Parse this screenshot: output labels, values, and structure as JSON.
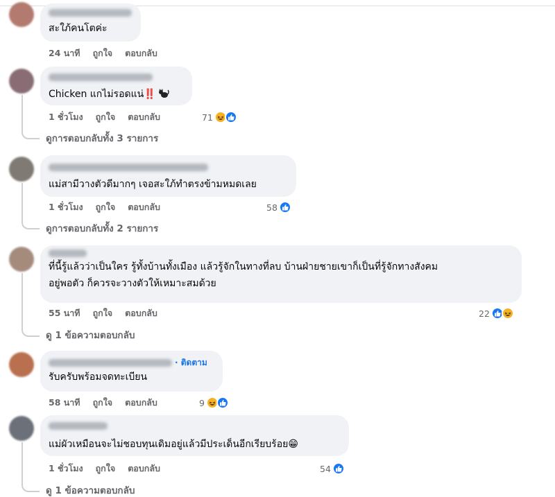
{
  "comments": [
    {
      "text": "สะใภ้คนโตค่ะ",
      "time": "24 นาที",
      "like_label": "ถูกใจ",
      "reply_label": "ตอบกลับ",
      "avatar_color": "#b37a6f"
    },
    {
      "text_main": "Chicken แกไม่รอดแน่",
      "text_emoji": "‼️",
      "time": "1 ชั่วโมง",
      "like_label": "ถูกใจ",
      "reply_label": "ตอบกลับ",
      "reaction_count": "71",
      "reactions": [
        "haha",
        "like"
      ],
      "view_replies": "ดูการตอบกลับทั้ง 3 รายการ",
      "avatar_color": "#8a6c74"
    },
    {
      "text": "แม่สามีวางตัวดีมากๆ เจอสะใภ้ทำตรงข้ามหมดเลย",
      "time": "1 ชั่วโมง",
      "like_label": "ถูกใจ",
      "reply_label": "ตอบกลับ",
      "reaction_count": "58",
      "reactions": [
        "like"
      ],
      "view_replies": "ดูการตอบกลับทั้ง 2 รายการ",
      "avatar_color": "#7f7a73"
    },
    {
      "text": "ที่นี้รู้แล้วว่าเป็นใคร รู้ทั้งบ้านทั้งเมือง แล้วรู้จักในทางที่ลบ บ้านฝ่ายชายเขาก็เป็นที่รู้จักทางสังคม\nอยู่พอตัว ก็ควรจะวางตัวให้เหมาะสมด้วย",
      "time": "55 นาที",
      "like_label": "ถูกใจ",
      "reply_label": "ตอบกลับ",
      "reaction_count": "22",
      "reactions": [
        "like",
        "haha"
      ],
      "view_replies": "ดู 1 ข้อความตอบกลับ",
      "avatar_color": "#a58b7c"
    },
    {
      "follow_label": "· ติดตาม",
      "text": "รับครับพร้อมจดทะเบียน",
      "time": "58 นาที",
      "like_label": "ถูกใจ",
      "reply_label": "ตอบกลับ",
      "reaction_count": "9",
      "reactions": [
        "haha",
        "like"
      ],
      "avatar_color": "#b8704e"
    },
    {
      "text": "แม่ผัวเหมือนจะไม่ชอบทุนเดิมอยู่แล้วมีประเด็นอีกเรียบร้อย😁",
      "time": "1 ชั่วโมง",
      "like_label": "ถูกใจ",
      "reply_label": "ตอบกลับ",
      "reaction_count": "54",
      "reactions": [
        "like"
      ],
      "view_replies": "ดู 1 ข้อความตอบกลับ",
      "avatar_color": "#6c7079"
    }
  ],
  "colors": {
    "bubble": "#f0f2f5",
    "meta_text": "#65676b",
    "like_blue": "#1877f2",
    "haha_yellow": "#f7b125",
    "follow_blue": "#1b74e4"
  }
}
